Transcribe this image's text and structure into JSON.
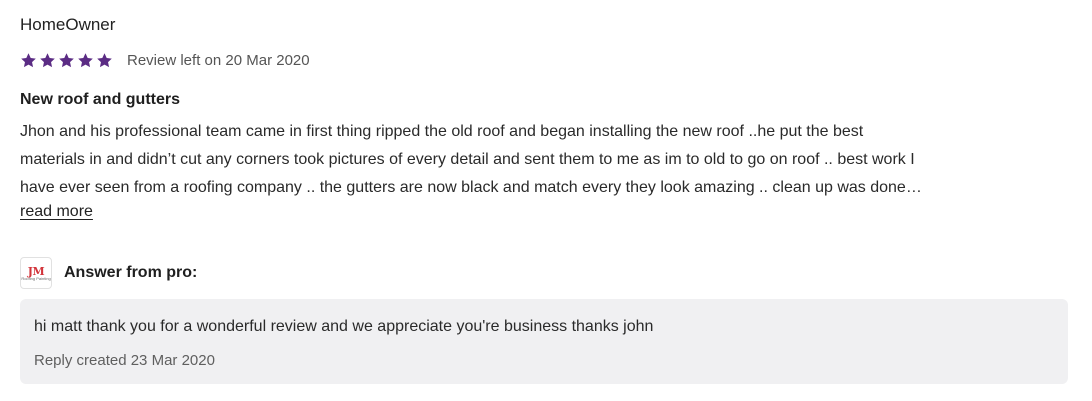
{
  "review": {
    "reviewer": "HomeOwner",
    "rating": 5,
    "rating_max": 5,
    "star_color": "#5b2c84",
    "date_text": "Review left on 20 Mar 2020",
    "title": "New roof and gutters",
    "body_lines": [
      "Jhon and his professional team came in first thing ripped the old roof and began installing the new roof ..he put the best",
      "materials in and didn’t cut any corners took pictures of every detail and sent them to me as im to old to go on roof .. best work I",
      "have ever seen from a roofing company .. the gutters are now black and match every they look amazing .. clean up was done…"
    ],
    "read_more_label": "read more"
  },
  "answer": {
    "logo_mark": "JM",
    "logo_text": "Roofing Painting",
    "label": "Answer from pro:",
    "reply_text": "hi matt thank you for a wonderful review and we appreciate you're business thanks john",
    "reply_date": "Reply created 23 Mar 2020",
    "box_color": "#f0f0f2"
  }
}
